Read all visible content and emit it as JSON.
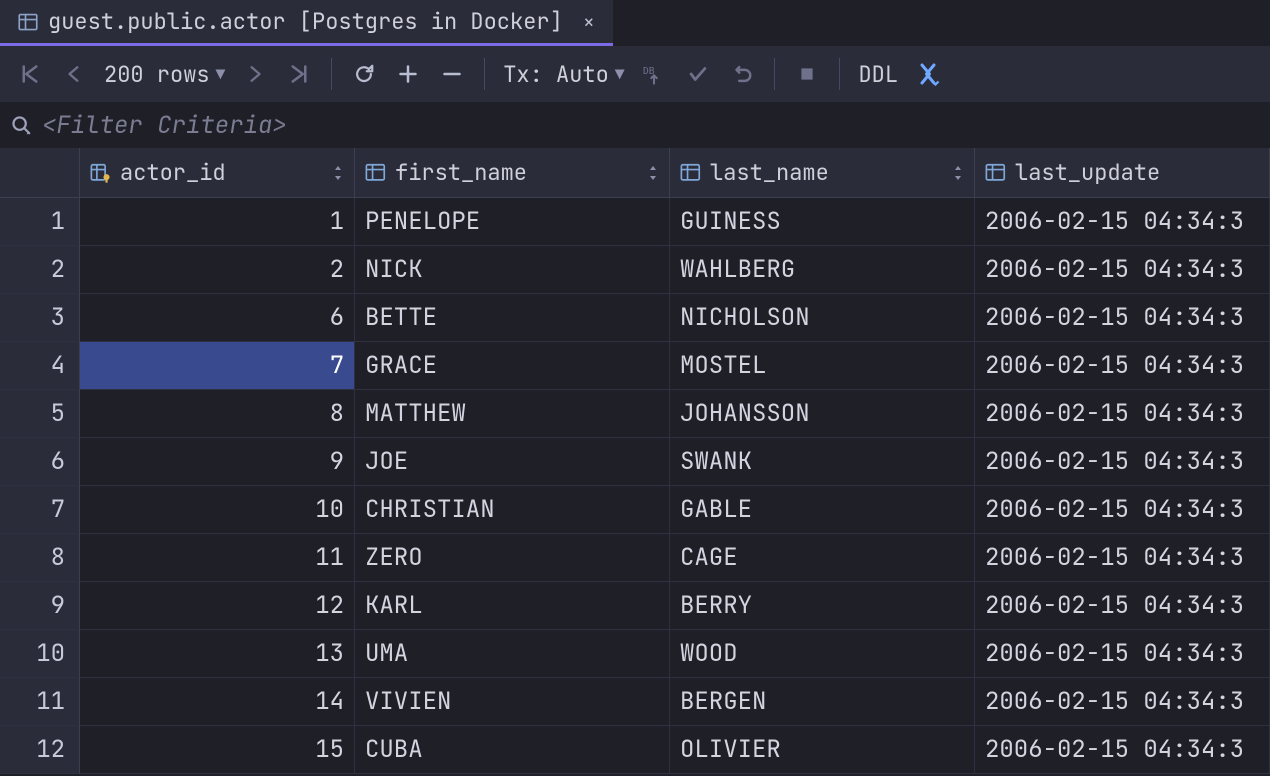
{
  "tab": {
    "title": "guest.public.actor [Postgres in Docker]"
  },
  "toolbar": {
    "rows_label": "200 rows",
    "tx_label": "Tx: Auto",
    "ddl_label": "DDL"
  },
  "filter": {
    "placeholder": "<Filter Criteria>"
  },
  "columns": [
    {
      "name": "actor_id",
      "key": true,
      "sortable": true,
      "numeric": true
    },
    {
      "name": "first_name",
      "key": false,
      "sortable": true,
      "numeric": false
    },
    {
      "name": "last_name",
      "key": false,
      "sortable": true,
      "numeric": false
    },
    {
      "name": "last_update",
      "key": false,
      "sortable": false,
      "numeric": false
    }
  ],
  "selected_row_index": 3,
  "selected_column_index": 0,
  "rows": [
    {
      "n": 1,
      "actor_id": 1,
      "first_name": "PENELOPE",
      "last_name": "GUINESS",
      "last_update": "2006-02-15 04:34:3"
    },
    {
      "n": 2,
      "actor_id": 2,
      "first_name": "NICK",
      "last_name": "WAHLBERG",
      "last_update": "2006-02-15 04:34:3"
    },
    {
      "n": 3,
      "actor_id": 6,
      "first_name": "BETTE",
      "last_name": "NICHOLSON",
      "last_update": "2006-02-15 04:34:3"
    },
    {
      "n": 4,
      "actor_id": 7,
      "first_name": "GRACE",
      "last_name": "MOSTEL",
      "last_update": "2006-02-15 04:34:3"
    },
    {
      "n": 5,
      "actor_id": 8,
      "first_name": "MATTHEW",
      "last_name": "JOHANSSON",
      "last_update": "2006-02-15 04:34:3"
    },
    {
      "n": 6,
      "actor_id": 9,
      "first_name": "JOE",
      "last_name": "SWANK",
      "last_update": "2006-02-15 04:34:3"
    },
    {
      "n": 7,
      "actor_id": 10,
      "first_name": "CHRISTIAN",
      "last_name": "GABLE",
      "last_update": "2006-02-15 04:34:3"
    },
    {
      "n": 8,
      "actor_id": 11,
      "first_name": "ZERO",
      "last_name": "CAGE",
      "last_update": "2006-02-15 04:34:3"
    },
    {
      "n": 9,
      "actor_id": 12,
      "first_name": "KARL",
      "last_name": "BERRY",
      "last_update": "2006-02-15 04:34:3"
    },
    {
      "n": 10,
      "actor_id": 13,
      "first_name": "UMA",
      "last_name": "WOOD",
      "last_update": "2006-02-15 04:34:3"
    },
    {
      "n": 11,
      "actor_id": 14,
      "first_name": "VIVIEN",
      "last_name": "BERGEN",
      "last_update": "2006-02-15 04:34:3"
    },
    {
      "n": 12,
      "actor_id": 15,
      "first_name": "CUBA",
      "last_name": "OLIVIER",
      "last_update": "2006-02-15 04:34:3"
    }
  ]
}
